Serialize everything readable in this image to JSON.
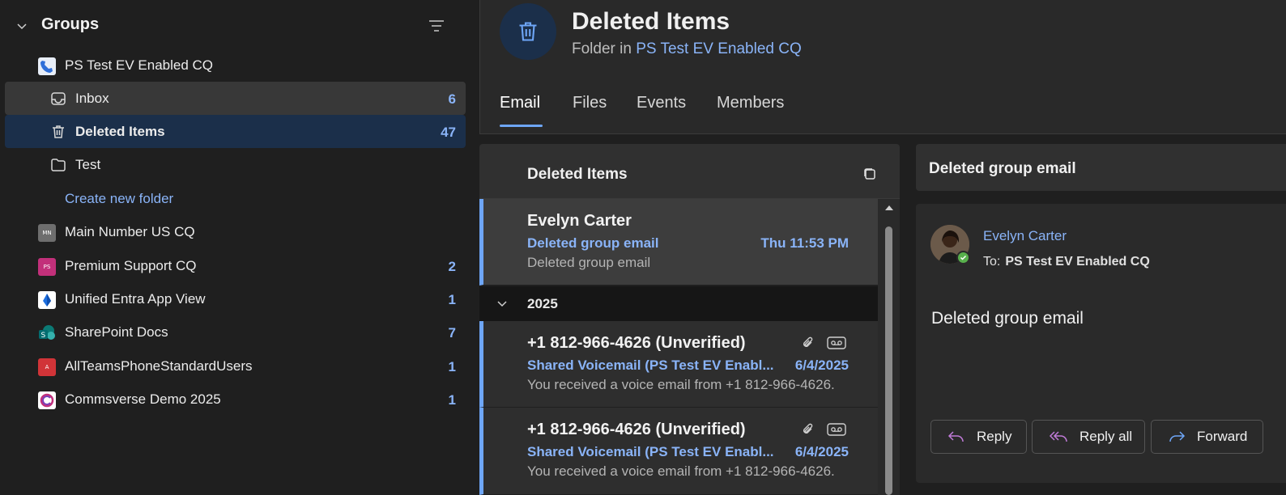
{
  "sidebar": {
    "groups_title": "Groups",
    "items": [
      {
        "label": "PS Test EV Enabled CQ",
        "count": "",
        "icon": "phone-group-icon"
      },
      {
        "label": "Inbox",
        "count": "6",
        "icon": "inbox-icon"
      },
      {
        "label": "Deleted Items",
        "count": "47",
        "icon": "trash-icon"
      },
      {
        "label": "Test",
        "count": "",
        "icon": "folder-icon"
      },
      {
        "label": "Create new folder",
        "count": "",
        "icon": ""
      },
      {
        "label": "Main Number US CQ",
        "count": "",
        "icon": "group-avatar-icon",
        "initials": "MN",
        "color": "#6e6e6e"
      },
      {
        "label": "Premium Support CQ",
        "count": "2",
        "icon": "group-avatar-icon",
        "initials": "PS",
        "color": "#c2307a"
      },
      {
        "label": "Unified Entra App View",
        "count": "1",
        "icon": "entra-icon"
      },
      {
        "label": "SharePoint Docs",
        "count": "7",
        "icon": "sharepoint-icon"
      },
      {
        "label": "AllTeamsPhoneStandardUsers",
        "count": "1",
        "icon": "group-avatar-icon",
        "initials": "A",
        "color": "#d13438"
      },
      {
        "label": "Commsverse Demo 2025",
        "count": "1",
        "icon": "commsverse-icon"
      }
    ]
  },
  "header": {
    "title": "Deleted Items",
    "subtitle_prefix": "Folder in",
    "subtitle_link": "PS Test EV Enabled CQ",
    "tabs": [
      "Email",
      "Files",
      "Events",
      "Members"
    ],
    "active_tab": "Email"
  },
  "list": {
    "title": "Deleted Items",
    "group_label": "2025",
    "messages": [
      {
        "from": "Evelyn Carter",
        "subject": "Deleted group email",
        "date": "Thu 11:53 PM",
        "preview": "Deleted group email",
        "selected": true
      },
      {
        "from": "+1 812-966-4626 (Unverified)",
        "subject": "Shared Voicemail (PS Test EV Enabl...",
        "date": "6/4/2025",
        "preview": "You received a voice email from +1 812-966-4626.",
        "selected": false
      },
      {
        "from": "+1 812-966-4626 (Unverified)",
        "subject": "Shared Voicemail (PS Test EV Enabl...",
        "date": "6/4/2025",
        "preview": "You received a voice email from +1 812-966-4626.",
        "selected": false
      }
    ]
  },
  "reading": {
    "title": "Deleted group email",
    "sender": "Evelyn Carter",
    "to_label": "To:",
    "to_value": "PS Test EV Enabled CQ",
    "body": "Deleted group email",
    "buttons": {
      "reply": "Reply",
      "reply_all": "Reply all",
      "forward": "Forward"
    }
  },
  "colors": {
    "accent": "#8ab4f8",
    "selected_bg": "#1b2f4a",
    "unread_bar": "#6ea6f7"
  }
}
